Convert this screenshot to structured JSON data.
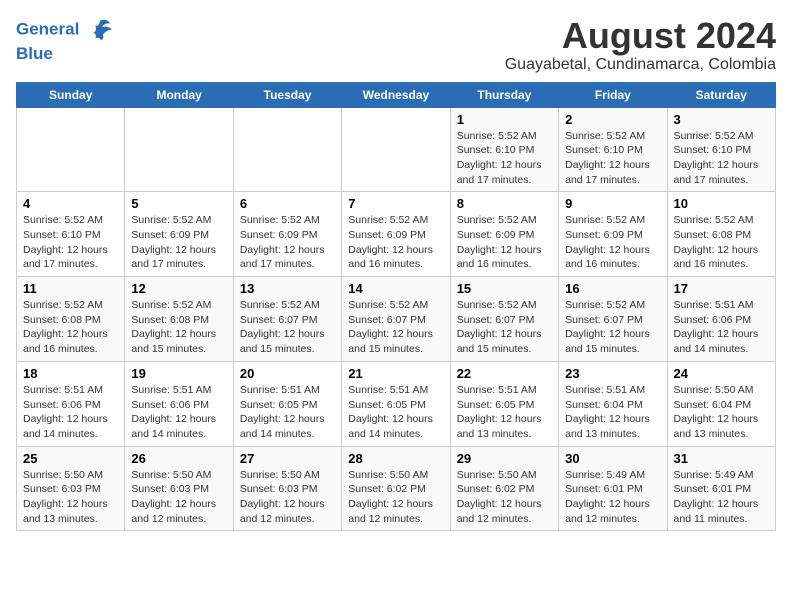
{
  "header": {
    "logo_line1": "General",
    "logo_line2": "Blue",
    "title": "August 2024",
    "subtitle": "Guayabetal, Cundinamarca, Colombia"
  },
  "calendar": {
    "days_of_week": [
      "Sunday",
      "Monday",
      "Tuesday",
      "Wednesday",
      "Thursday",
      "Friday",
      "Saturday"
    ],
    "weeks": [
      [
        {
          "day": "",
          "info": ""
        },
        {
          "day": "",
          "info": ""
        },
        {
          "day": "",
          "info": ""
        },
        {
          "day": "",
          "info": ""
        },
        {
          "day": "1",
          "info": "Sunrise: 5:52 AM\nSunset: 6:10 PM\nDaylight: 12 hours\nand 17 minutes."
        },
        {
          "day": "2",
          "info": "Sunrise: 5:52 AM\nSunset: 6:10 PM\nDaylight: 12 hours\nand 17 minutes."
        },
        {
          "day": "3",
          "info": "Sunrise: 5:52 AM\nSunset: 6:10 PM\nDaylight: 12 hours\nand 17 minutes."
        }
      ],
      [
        {
          "day": "4",
          "info": "Sunrise: 5:52 AM\nSunset: 6:10 PM\nDaylight: 12 hours\nand 17 minutes."
        },
        {
          "day": "5",
          "info": "Sunrise: 5:52 AM\nSunset: 6:09 PM\nDaylight: 12 hours\nand 17 minutes."
        },
        {
          "day": "6",
          "info": "Sunrise: 5:52 AM\nSunset: 6:09 PM\nDaylight: 12 hours\nand 17 minutes."
        },
        {
          "day": "7",
          "info": "Sunrise: 5:52 AM\nSunset: 6:09 PM\nDaylight: 12 hours\nand 16 minutes."
        },
        {
          "day": "8",
          "info": "Sunrise: 5:52 AM\nSunset: 6:09 PM\nDaylight: 12 hours\nand 16 minutes."
        },
        {
          "day": "9",
          "info": "Sunrise: 5:52 AM\nSunset: 6:09 PM\nDaylight: 12 hours\nand 16 minutes."
        },
        {
          "day": "10",
          "info": "Sunrise: 5:52 AM\nSunset: 6:08 PM\nDaylight: 12 hours\nand 16 minutes."
        }
      ],
      [
        {
          "day": "11",
          "info": "Sunrise: 5:52 AM\nSunset: 6:08 PM\nDaylight: 12 hours\nand 16 minutes."
        },
        {
          "day": "12",
          "info": "Sunrise: 5:52 AM\nSunset: 6:08 PM\nDaylight: 12 hours\nand 15 minutes."
        },
        {
          "day": "13",
          "info": "Sunrise: 5:52 AM\nSunset: 6:07 PM\nDaylight: 12 hours\nand 15 minutes."
        },
        {
          "day": "14",
          "info": "Sunrise: 5:52 AM\nSunset: 6:07 PM\nDaylight: 12 hours\nand 15 minutes."
        },
        {
          "day": "15",
          "info": "Sunrise: 5:52 AM\nSunset: 6:07 PM\nDaylight: 12 hours\nand 15 minutes."
        },
        {
          "day": "16",
          "info": "Sunrise: 5:52 AM\nSunset: 6:07 PM\nDaylight: 12 hours\nand 15 minutes."
        },
        {
          "day": "17",
          "info": "Sunrise: 5:51 AM\nSunset: 6:06 PM\nDaylight: 12 hours\nand 14 minutes."
        }
      ],
      [
        {
          "day": "18",
          "info": "Sunrise: 5:51 AM\nSunset: 6:06 PM\nDaylight: 12 hours\nand 14 minutes."
        },
        {
          "day": "19",
          "info": "Sunrise: 5:51 AM\nSunset: 6:06 PM\nDaylight: 12 hours\nand 14 minutes."
        },
        {
          "day": "20",
          "info": "Sunrise: 5:51 AM\nSunset: 6:05 PM\nDaylight: 12 hours\nand 14 minutes."
        },
        {
          "day": "21",
          "info": "Sunrise: 5:51 AM\nSunset: 6:05 PM\nDaylight: 12 hours\nand 14 minutes."
        },
        {
          "day": "22",
          "info": "Sunrise: 5:51 AM\nSunset: 6:05 PM\nDaylight: 12 hours\nand 13 minutes."
        },
        {
          "day": "23",
          "info": "Sunrise: 5:51 AM\nSunset: 6:04 PM\nDaylight: 12 hours\nand 13 minutes."
        },
        {
          "day": "24",
          "info": "Sunrise: 5:50 AM\nSunset: 6:04 PM\nDaylight: 12 hours\nand 13 minutes."
        }
      ],
      [
        {
          "day": "25",
          "info": "Sunrise: 5:50 AM\nSunset: 6:03 PM\nDaylight: 12 hours\nand 13 minutes."
        },
        {
          "day": "26",
          "info": "Sunrise: 5:50 AM\nSunset: 6:03 PM\nDaylight: 12 hours\nand 12 minutes."
        },
        {
          "day": "27",
          "info": "Sunrise: 5:50 AM\nSunset: 6:03 PM\nDaylight: 12 hours\nand 12 minutes."
        },
        {
          "day": "28",
          "info": "Sunrise: 5:50 AM\nSunset: 6:02 PM\nDaylight: 12 hours\nand 12 minutes."
        },
        {
          "day": "29",
          "info": "Sunrise: 5:50 AM\nSunset: 6:02 PM\nDaylight: 12 hours\nand 12 minutes."
        },
        {
          "day": "30",
          "info": "Sunrise: 5:49 AM\nSunset: 6:01 PM\nDaylight: 12 hours\nand 12 minutes."
        },
        {
          "day": "31",
          "info": "Sunrise: 5:49 AM\nSunset: 6:01 PM\nDaylight: 12 hours\nand 11 minutes."
        }
      ]
    ]
  }
}
